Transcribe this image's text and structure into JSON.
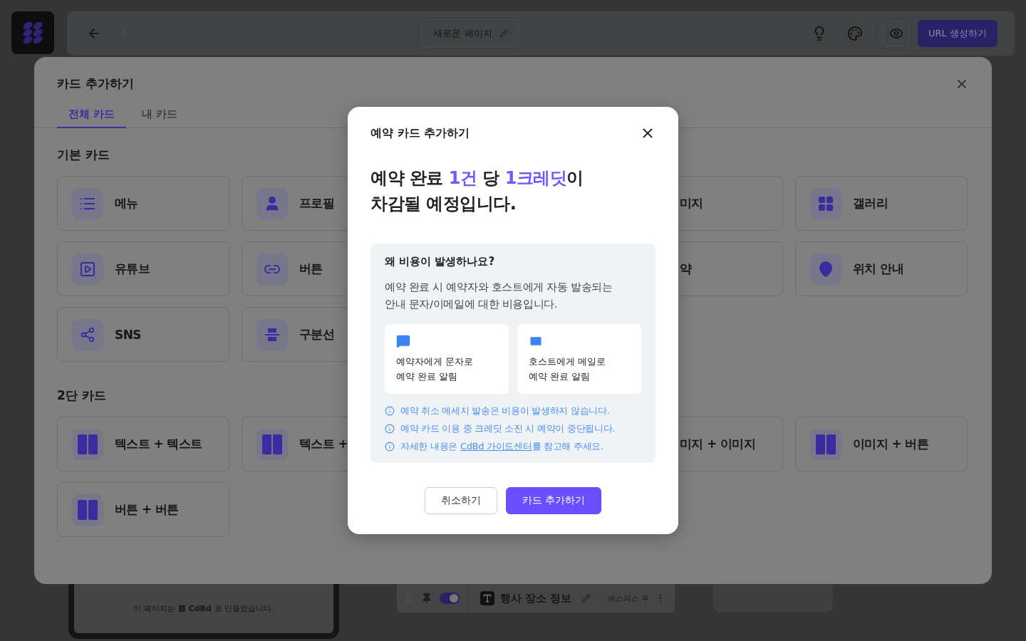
{
  "topbar": {
    "page_title": "새로운 페이지",
    "url_button": "URL 생성하기"
  },
  "modal": {
    "title": "카드 추가하기",
    "tabs": [
      {
        "label": "전체 카드",
        "selected": true
      },
      {
        "label": "내 카드",
        "selected": false
      }
    ],
    "sections": [
      {
        "title": "기본 카드",
        "rows": [
          {
            "left": [
              {
                "kind": "list",
                "label": "메뉴"
              },
              {
                "kind": "person",
                "label": "프로필"
              }
            ],
            "right": [
              {
                "kind": "partial",
                "label": "미지"
              },
              {
                "kind": "grid",
                "label": "갤러리"
              }
            ]
          },
          {
            "left": [
              {
                "kind": "play",
                "label": "유튜브"
              },
              {
                "kind": "link",
                "label": "버튼"
              }
            ],
            "right": [
              {
                "kind": "partial",
                "label": "약"
              },
              {
                "kind": "pin",
                "label": "위치 안내"
              }
            ]
          },
          {
            "left": [
              {
                "kind": "share",
                "label": "SNS"
              },
              {
                "kind": "divider",
                "label": "구분선"
              }
            ],
            "right": []
          }
        ]
      },
      {
        "title": "2단 카드",
        "rows": [
          {
            "left": [
              {
                "kind": "columns",
                "label": "텍스트 + 텍스트"
              },
              {
                "kind": "columns",
                "label": "텍스트 +"
              }
            ],
            "right": [
              {
                "kind": "partial",
                "label": "미지 + 이미지"
              },
              {
                "kind": "columns",
                "label": "이미지 + 버튼"
              }
            ]
          },
          {
            "left": [
              {
                "kind": "columns",
                "label": "버튼 + 버튼"
              }
            ],
            "right": []
          }
        ]
      }
    ]
  },
  "dialog": {
    "title": "예약 카드 추가하기",
    "headline": "예약 완료 **1건** 당 **1크레딧**이\n차감될 예정입니다.",
    "info": {
      "question": "왜 비용이 발생하나요?",
      "text": "예약 완료 시 예약자와 호스트에게 자동 발송되는\n안내 문자/이메일에 대한 비용입니다.",
      "channels": [
        {
          "kind": "message",
          "text": "예약자에게 문자로\n예약 완료 알림"
        },
        {
          "kind": "mail",
          "text": "호스트에게 메일로\n예약 완료 알림"
        }
      ],
      "notes": [
        {
          "text": "예약 취소 메세지 발송은 비용이 발생하지 않습니다."
        },
        {
          "text": "예약 카드 이용 중 크레딧 소진 시 예약이 중단됩니다."
        },
        {
          "text": "자세한 내용은 ",
          "link": "CdBd 가이드센터",
          "after": "를 참고해 주세요."
        }
      ]
    },
    "buttons": {
      "cancel": "취소하기",
      "confirm": "카드 추가하기"
    }
  },
  "footer": {
    "made_with": {
      "before": "이 페이지는",
      "brand": "CdBd",
      "after": "로 만들었습니다."
    },
    "block": {
      "toggle_on": true,
      "title": "행사 장소 정보",
      "place": "에스파스 루"
    }
  }
}
